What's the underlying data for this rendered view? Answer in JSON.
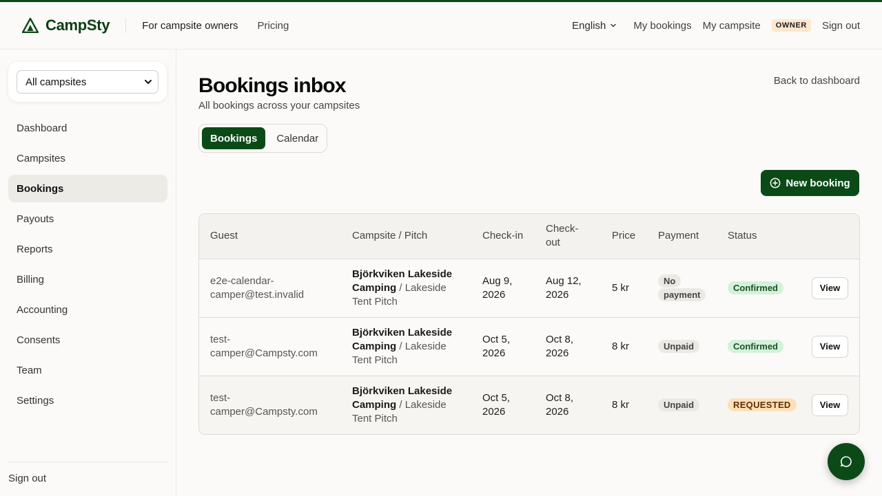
{
  "header": {
    "brand": "CampSty",
    "nav": [
      "For campsite owners",
      "Pricing"
    ],
    "language": "English",
    "my_bookings": "My bookings",
    "my_campsite": "My campsite",
    "role_badge": "OWNER",
    "sign_out": "Sign out"
  },
  "sidebar": {
    "campsite_select": "All campsites",
    "items": [
      {
        "label": "Dashboard"
      },
      {
        "label": "Campsites"
      },
      {
        "label": "Bookings"
      },
      {
        "label": "Payouts"
      },
      {
        "label": "Reports"
      },
      {
        "label": "Billing"
      },
      {
        "label": "Accounting"
      },
      {
        "label": "Consents"
      },
      {
        "label": "Team"
      },
      {
        "label": "Settings"
      }
    ],
    "active": "Bookings",
    "sign_out": "Sign out"
  },
  "main": {
    "title": "Bookings inbox",
    "subtitle": "All bookings across your campsites",
    "back_link": "Back to dashboard",
    "tabs": [
      "Bookings",
      "Calendar"
    ],
    "new_booking": "New booking",
    "columns": [
      "Guest",
      "Campsite / Pitch",
      "Check-in",
      "Check-out",
      "Price",
      "Payment",
      "Status",
      ""
    ],
    "rows": [
      {
        "guest": "e2e-calendar-camper@test.invalid",
        "campsite": "Björkviken Lakeside Camping",
        "sep": " / ",
        "pitch": "Lakeside Tent Pitch",
        "check_in": "Aug 9, 2026",
        "check_out": "Aug 12, 2026",
        "price": "5 kr",
        "payment": "No payment",
        "status": "Confirmed",
        "action": "View"
      },
      {
        "guest": "test-camper@Campsty.com",
        "campsite": "Björkviken Lakeside Camping",
        "sep": " / ",
        "pitch": "Lakeside Tent Pitch",
        "check_in": "Oct 5, 2026",
        "check_out": "Oct 8, 2026",
        "price": "8 kr",
        "payment": "Unpaid",
        "status": "Confirmed",
        "action": "View"
      },
      {
        "guest": "test-camper@Campsty.com",
        "campsite": "Björkviken Lakeside Camping",
        "sep": " / ",
        "pitch": "Lakeside Tent Pitch",
        "check_in": "Oct 5, 2026",
        "check_out": "Oct 8, 2026",
        "price": "8 kr",
        "payment": "Unpaid",
        "status": "REQUESTED",
        "action": "View"
      }
    ]
  },
  "colors": {
    "brand_green": "#0b4a17",
    "confirmed_bg": "#d4f1da",
    "requested_bg": "#fde0b8",
    "owner_badge_bg": "#fde7cf"
  },
  "icons": [
    "campsty-logo-icon",
    "chevron-down-icon",
    "plus-circle-icon",
    "chat-bubble-icon"
  ]
}
